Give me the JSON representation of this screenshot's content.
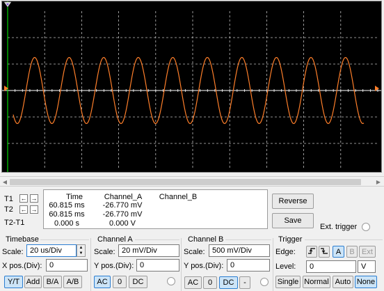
{
  "cursors": {
    "t1_label": "T1",
    "t2_label": "T2",
    "diff_label": "T2-T1",
    "arrow_left": "←",
    "arrow_right": "→"
  },
  "measure": {
    "headers": {
      "time": "Time",
      "channel_a": "Channel_A",
      "channel_b": "Channel_B"
    },
    "t1": {
      "time": "60.815 ms",
      "channel_a": "-26.770 mV",
      "channel_b": ""
    },
    "t2": {
      "time": "60.815 ms",
      "channel_a": "-26.770 mV",
      "channel_b": ""
    },
    "diff": {
      "time": "0.000 s",
      "channel_a": "0.000 V",
      "channel_b": ""
    }
  },
  "actions": {
    "reverse": "Reverse",
    "save": "Save",
    "ext_trigger": "Ext. trigger"
  },
  "timebase": {
    "title": "Timebase",
    "scale_label": "Scale:",
    "scale_value": "20 us/Div",
    "xpos_label": "X pos.(Div):",
    "xpos_value": "0",
    "modes": [
      "Y/T",
      "Add",
      "B/A",
      "A/B"
    ],
    "active_mode": "Y/T"
  },
  "channel_a": {
    "title": "Channel A",
    "scale_label": "Scale:",
    "scale_value": "20 mV/Div",
    "ypos_label": "Y pos.(Div):",
    "ypos_value": "0",
    "coupling": [
      "AC",
      "0",
      "DC"
    ],
    "active_coupling": "AC"
  },
  "channel_b": {
    "title": "Channel B",
    "scale_label": "Scale:",
    "scale_value": "500 mV/Div",
    "ypos_label": "Y pos.(Div):",
    "ypos_value": "0",
    "coupling": [
      "AC",
      "0",
      "DC",
      "-"
    ],
    "active_coupling": "DC"
  },
  "trigger": {
    "title": "Trigger",
    "edge_label": "Edge:",
    "edges": [
      "rising-edge-icon",
      "falling-edge-icon"
    ],
    "sources": [
      "A",
      "B",
      "Ext"
    ],
    "active_source": "A",
    "level_label": "Level:",
    "level_value": "0",
    "level_unit": "V",
    "modes": [
      "Single",
      "Normal",
      "Auto",
      "None"
    ],
    "active_mode": "None"
  },
  "colors": {
    "trace": "#ff7f2a",
    "grid": "#ffffff",
    "screen": "#000000",
    "cursor": "#00ff00"
  },
  "waveform": {
    "cycles": 10,
    "amplitude_div": 1.25,
    "offset_div": 0
  }
}
